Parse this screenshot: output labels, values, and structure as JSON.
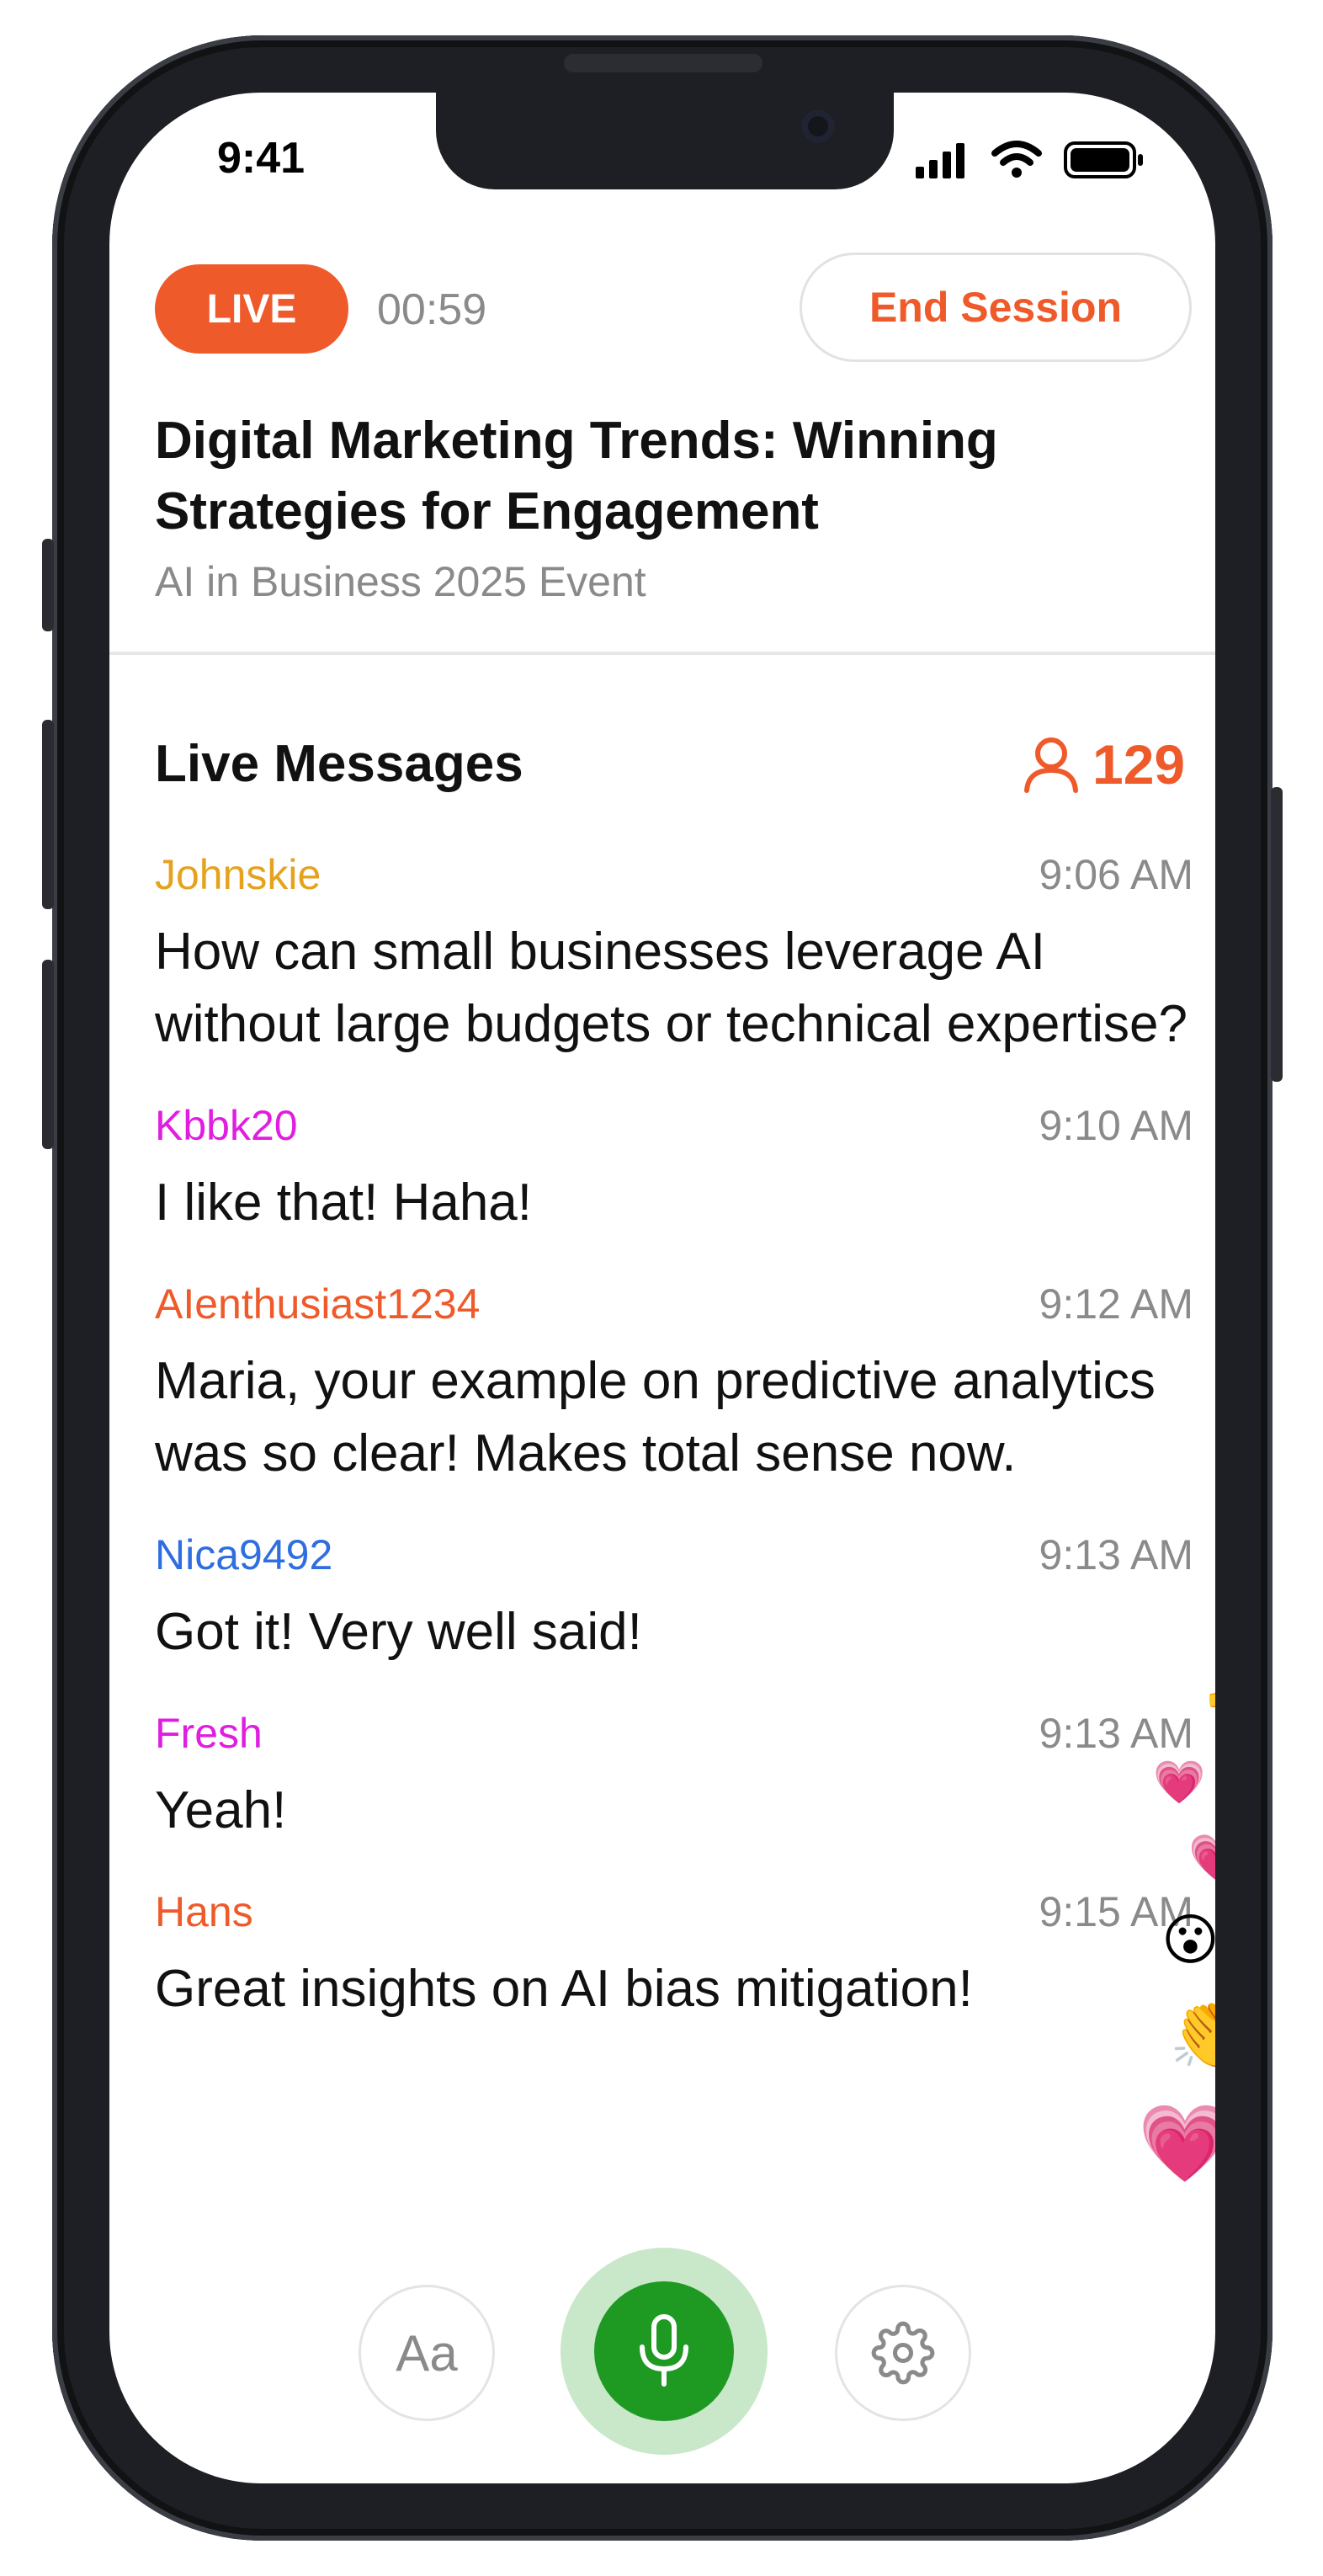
{
  "status_bar": {
    "time": "9:41"
  },
  "session": {
    "live_label": "LIVE",
    "timer": "00:59",
    "end_label": "End Session",
    "title": "Digital Marketing Trends: Winning Strategies for Engagement",
    "subtitle": "AI in Business 2025 Event"
  },
  "messages_panel": {
    "title": "Live Messages",
    "viewer_count": "129",
    "messages": [
      {
        "user": "Johnskie",
        "time": "9:06 AM",
        "text": "How can small businesses leverage AI without large budgets or technical expertise?",
        "color": "#e6a21c"
      },
      {
        "user": "Kbbk20",
        "time": "9:10 AM",
        "text": "I like that! Haha!",
        "color": "#e01ee0"
      },
      {
        "user": "AIenthusiast1234",
        "time": "9:12 AM",
        "text": "Maria, your example on predictive analytics was so clear! Makes total sense now.",
        "color": "#ef5a2b"
      },
      {
        "user": "Nica9492",
        "time": "9:13 AM",
        "text": "Got it! Very well said!",
        "color": "#2f6ee0"
      },
      {
        "user": "Fresh",
        "time": "9:13 AM",
        "text": "Yeah!",
        "color": "#e01ee0"
      },
      {
        "user": "Hans",
        "time": "9:15 AM",
        "text": "Great insights on AI bias mitigation!",
        "color": "#ef5a2b"
      }
    ]
  },
  "reactions": [
    {
      "emoji": "👍",
      "name": "thumbs-up"
    },
    {
      "emoji": "💗",
      "name": "pink-heart"
    },
    {
      "emoji": "💗",
      "name": "pink-heart"
    },
    {
      "emoji": "😮",
      "name": "surprised-face"
    },
    {
      "emoji": "👏",
      "name": "clapping-hands"
    },
    {
      "emoji": "💗",
      "name": "pink-heart"
    }
  ],
  "controls": {
    "text_size_label": "Aa",
    "mic_icon": "microphone-icon",
    "settings_icon": "gear-icon"
  },
  "colors": {
    "accent": "#ef5a2b",
    "mic_green": "#1e9a23",
    "mic_halo": "#c9e7c9",
    "muted_text": "#8a8a8a"
  }
}
